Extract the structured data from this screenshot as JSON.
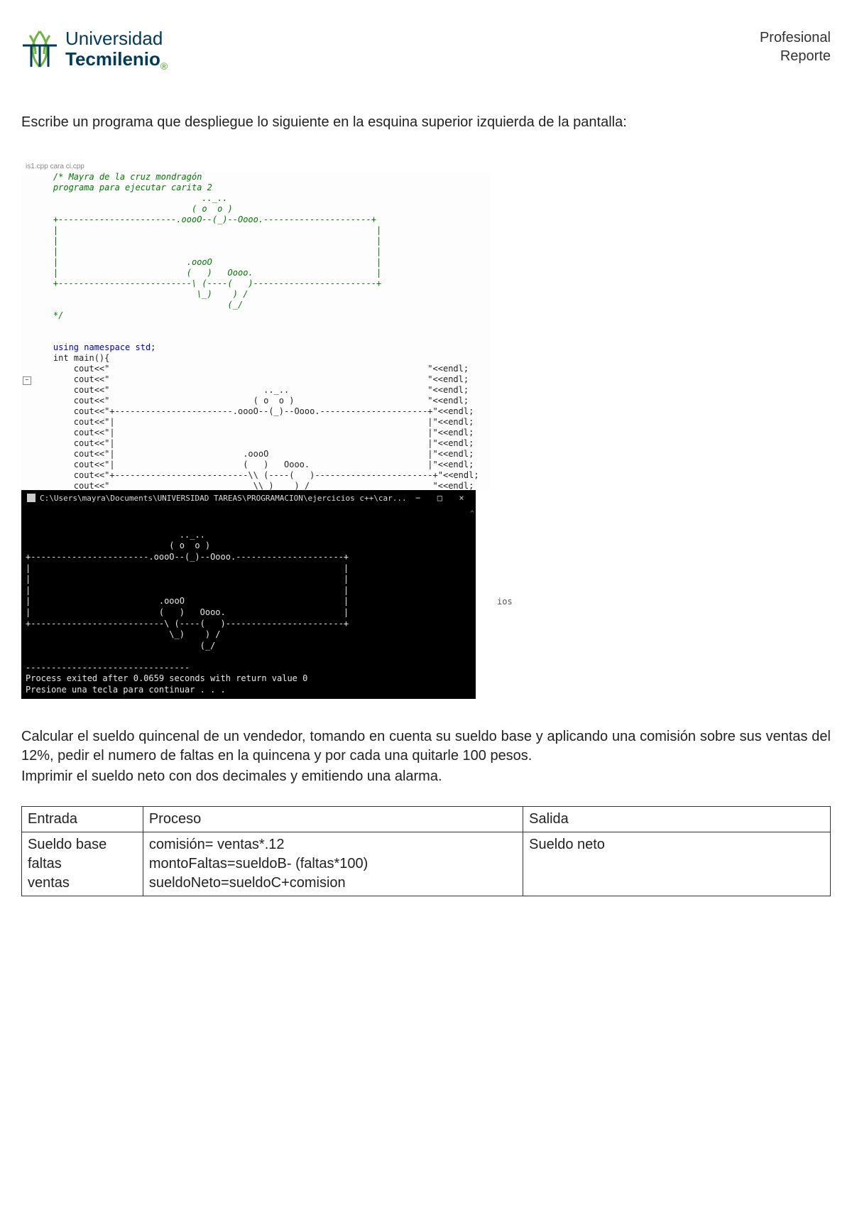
{
  "header": {
    "logo_line1": "Universidad",
    "logo_line2": "Tecmilenio",
    "right_line1": "Profesional",
    "right_line2": "Reporte"
  },
  "instruction": "Escribe un programa que despliegue lo siguiente en la esquina superior izquierda de la pantalla:",
  "ide": {
    "tab": "is1.cpp  cara ci.cpp",
    "comment": "    /* Mayra de la cruz mondragón\n    programa para ejecutar carita 2\n                                 .._..\n                               ( o  o )\n    +-----------------------.oooO--(_)--Oooo.---------------------+\n    |                                                              |\n    |                                                              |\n    |                                                              |\n    |                         .oooO                                |\n    |                         (   )   Oooo.                        |\n    +--------------------------\\ (----(   )------------------------+\n                                \\_)    ) /\n                                      (_/\n    */",
    "kw_line": "    using namespace std;",
    "main_line": "    int main(){",
    "cout_lines": [
      "        cout<<\"                                                              \"<<endl;",
      "        cout<<\"                                                              \"<<endl;",
      "        cout<<\"                              .._..                           \"<<endl;",
      "        cout<<\"                            ( o  o )                          \"<<endl;",
      "        cout<<\"+-----------------------.oooO--(_)--Oooo.---------------------+\"<<endl;",
      "        cout<<\"|                                                             |\"<<endl;",
      "        cout<<\"|                                                             |\"<<endl;",
      "        cout<<\"|                                                             |\"<<endl;",
      "        cout<<\"|                         .oooO                               |\"<<endl;",
      "        cout<<\"|                         (   )   Oooo.                       |\"<<endl;",
      "        cout<<\"+--------------------------\\\\ (----(   )-----------------------+\"<<endl;",
      "        cout<<\"                            \\\\_)    ) /                        \"<<endl;"
    ]
  },
  "console": {
    "title": "C:\\Users\\mayra\\Documents\\UNIVERSIDAD TAREAS\\PROGRAMACION\\ejercicios c++\\car...",
    "output": "\n                              .._..\n                            ( o  o )\n+-----------------------.oooO--(_)--Oooo.---------------------+\n|                                                             |\n|                                                             |\n|                                                             |\n|                         .oooO                               |\n|                         (   )   Oooo.                       |\n+--------------------------\\ (----(   )-----------------------+\n                            \\_)    ) /\n                                  (_/\n\n--------------------------------\nProcess exited after 0.0659 seconds with return value 0\nPresione una tecla para continuar . . ."
  },
  "ios_fragment": "ios",
  "p2_line1": "Calcular el sueldo quincenal de un vendedor, tomando en cuenta su sueldo base y aplicando una comisión sobre sus ventas del 12%, pedir el numero de faltas en la quincena y por cada una quitarle 100 pesos.",
  "p2_line2": "Imprimir el sueldo neto con dos decimales y emitiendo una alarma.",
  "table": {
    "h_entrada": "Entrada",
    "h_proceso": "Proceso",
    "h_salida": "Salida",
    "entrada": "Sueldo base\nfaltas\nventas",
    "proceso": "comisión= ventas*.12\nmontoFaltas=sueldoB- (faltas*100)\nsueldoNeto=sueldoC+comision",
    "salida": "Sueldo neto"
  }
}
